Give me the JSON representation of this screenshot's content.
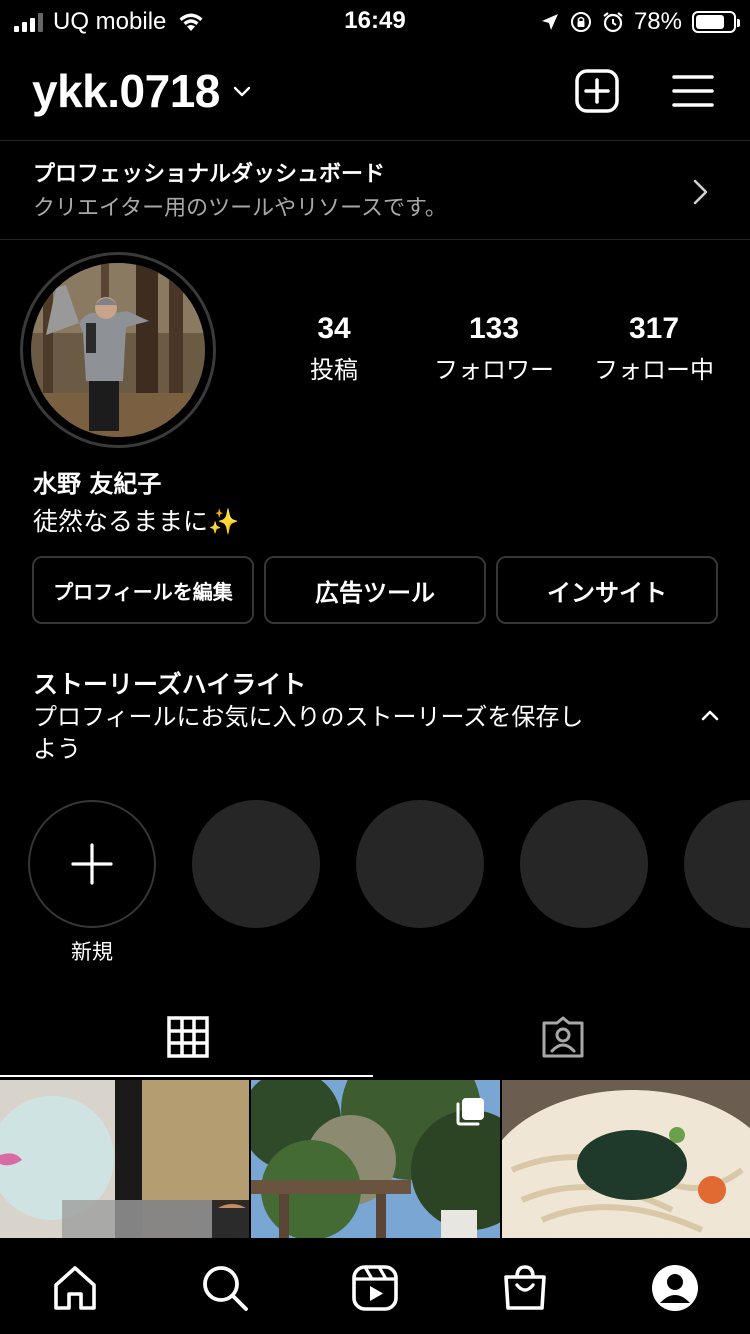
{
  "status_bar": {
    "carrier": "UQ mobile",
    "time": "16:49",
    "battery_percent": "78%",
    "battery_level": 0.78
  },
  "header": {
    "username": "ykk.0718"
  },
  "dashboard": {
    "title": "プロフェッショナルダッシュボード",
    "subtitle": "クリエイター用のツールやリソースです。"
  },
  "profile": {
    "stats": [
      {
        "value": "34",
        "label": "投稿"
      },
      {
        "value": "133",
        "label": "フォロワー"
      },
      {
        "value": "317",
        "label": "フォロー中"
      }
    ],
    "display_name": "水野 友紀子",
    "bio": "徒然なるままに✨"
  },
  "buttons": {
    "edit_profile": "プロフィールを編集",
    "ad_tools": "広告ツール",
    "insights": "インサイト"
  },
  "highlights": {
    "title": "ストーリーズハイライト",
    "subtitle": "プロフィールにお気に入りのストーリーズを保存しよう",
    "new_label": "新規"
  },
  "colors": {
    "background": "#000000",
    "secondary_text": "#a8a8a8",
    "divider": "#262626",
    "button_border": "#363636"
  }
}
